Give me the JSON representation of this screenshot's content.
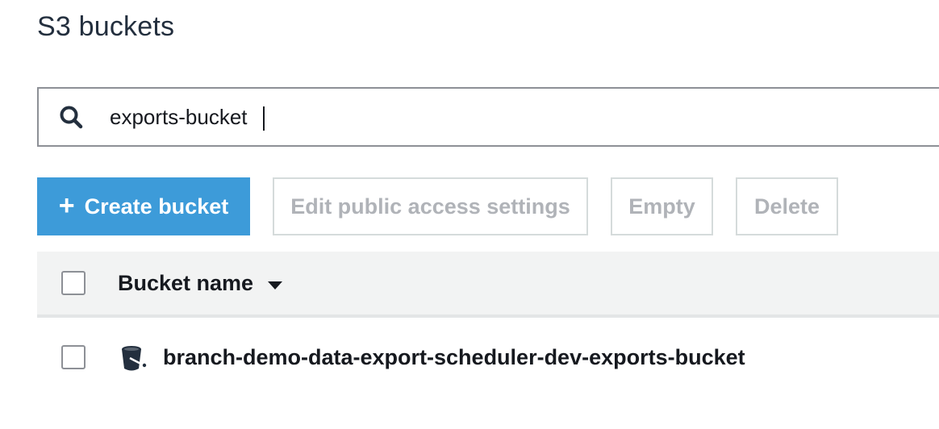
{
  "page": {
    "title": "S3 buckets"
  },
  "search": {
    "value": "exports-bucket",
    "icon": "search-icon"
  },
  "toolbar": {
    "create_label": "Create bucket",
    "create_icon": "plus-icon",
    "edit_access_label": "Edit public access settings",
    "empty_label": "Empty",
    "delete_label": "Delete"
  },
  "table": {
    "columns": [
      {
        "label": "Bucket name",
        "sort": "descending"
      }
    ],
    "rows": [
      {
        "name": "branch-demo-data-export-scheduler-dev-exports-bucket",
        "icon": "bucket-icon",
        "selected": false
      }
    ]
  },
  "colors": {
    "primary": "#3d9bd9",
    "disabled_text": "#b0b3b8",
    "header_bg": "#f2f3f3"
  }
}
